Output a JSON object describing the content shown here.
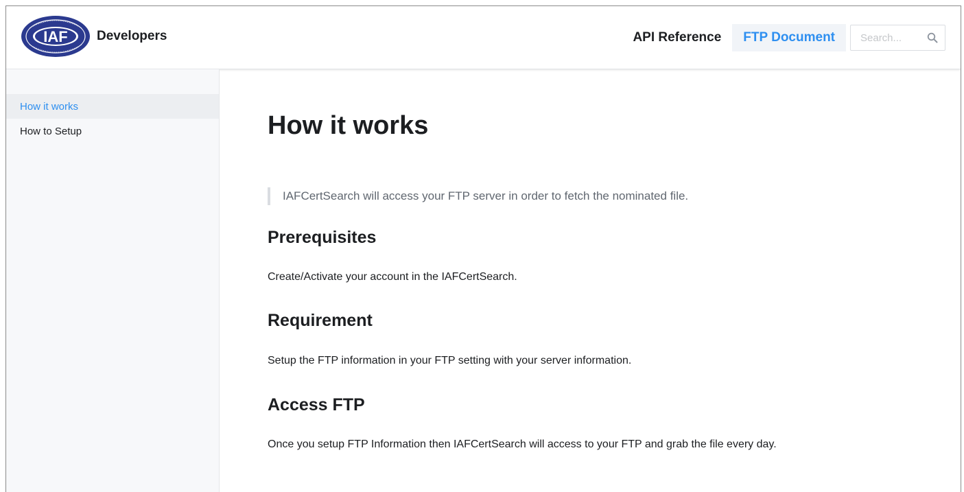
{
  "header": {
    "logo_text": "IAF",
    "logo_ring_text": "INTERNATIONAL ACCREDITATION FORUM",
    "brand_title": "Developers",
    "nav": [
      {
        "label": "API Reference",
        "active": false
      },
      {
        "label": "FTP Document",
        "active": true
      }
    ],
    "search": {
      "placeholder": "Search...",
      "value": ""
    }
  },
  "sidebar": {
    "items": [
      {
        "label": "How it works",
        "active": true
      },
      {
        "label": "How to Setup",
        "active": false
      }
    ]
  },
  "main": {
    "title": "How it works",
    "quote": "IAFCertSearch will access your FTP server in order to fetch the nominated file.",
    "sections": [
      {
        "heading": "Prerequisites",
        "text": "Create/Activate your account in the IAFCertSearch."
      },
      {
        "heading": "Requirement",
        "text": "Setup the FTP information in your FTP setting with your server information."
      },
      {
        "heading": "Access FTP",
        "text": "Once you setup FTP Information then IAFCertSearch will access to your FTP and grab the file every day."
      }
    ]
  },
  "colors": {
    "accent": "#2e8ff0",
    "logo_blue": "#2b3a8f",
    "text": "#1c1e21",
    "muted": "#606770",
    "sidebar_bg": "#f7f8fa"
  }
}
